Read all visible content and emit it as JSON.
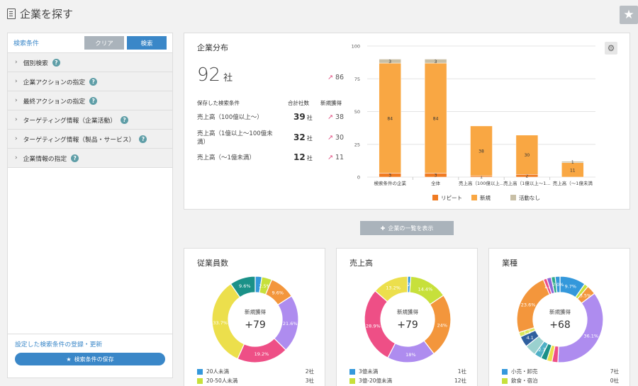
{
  "header": {
    "title": "企業を探す"
  },
  "sidebar": {
    "search_label": "検索条件",
    "clear_label": "クリア",
    "search_button": "検索",
    "items": [
      {
        "label": "個別検索"
      },
      {
        "label": "企業アクションの指定"
      },
      {
        "label": "最終アクションの指定"
      },
      {
        "label": "ターゲティング情報（企業活動）"
      },
      {
        "label": "ターゲティング情報（製品・サービス）"
      },
      {
        "label": "企業情報の指定"
      }
    ],
    "help_mark": "?",
    "register_link": "設定した検索条件の登録・更新",
    "save_button": "検索条件の保存"
  },
  "distribution": {
    "title": "企業分布",
    "total": "92",
    "total_unit": "社",
    "total_new": "86",
    "col_saved": "保存した検索条件",
    "col_total": "合計社数",
    "col_new": "新規獲得",
    "rows": [
      {
        "label": "売上高（100億以上～）",
        "count": "39",
        "unit": "社",
        "new": "38"
      },
      {
        "label": "売上高（1億以上～100億未満）",
        "count": "32",
        "unit": "社",
        "new": "30"
      },
      {
        "label": "売上高（～1億未満）",
        "count": "12",
        "unit": "社",
        "new": "11"
      }
    ]
  },
  "chart_data": [
    {
      "type": "bar",
      "stacked": true,
      "categories": [
        "検索条件の企業",
        "全体",
        "売上高（100億以上...",
        "売上高（1億以上～1...",
        "売上高（～1億未満"
      ],
      "series": [
        {
          "name": "リピート",
          "values": [
            3,
            3,
            1,
            2,
            0
          ],
          "color": "#f07b22"
        },
        {
          "name": "新規",
          "values": [
            84,
            84,
            38,
            30,
            11
          ],
          "color": "#f9a743"
        },
        {
          "name": "活動なし",
          "values": [
            3,
            3,
            0,
            0,
            1
          ],
          "color": "#c8bfa6"
        }
      ],
      "ylim": [
        0,
        100
      ],
      "yticks": [
        0,
        25,
        50,
        75,
        100
      ],
      "grid": true,
      "legend": "bottom"
    },
    {
      "type": "pie",
      "donut": true,
      "title": "従業員数",
      "center_label": "新規獲得",
      "center_value": "+79",
      "slices": [
        {
          "value": 2.5,
          "color": "#3498db",
          "label": ""
        },
        {
          "value": 3.8,
          "color": "#c7e03b",
          "label": "2.5%"
        },
        {
          "value": 9.6,
          "color": "#f3963c",
          "label": "9.6%"
        },
        {
          "value": 21.6,
          "color": "#ae8cef",
          "label": "21.6%"
        },
        {
          "value": 19.2,
          "color": "#ee4f86",
          "label": "19.2%"
        },
        {
          "value": 33.7,
          "color": "#ecdf4c",
          "label": "33.7%"
        },
        {
          "value": 9.6,
          "color": "#1b9188",
          "label": "9.6%"
        }
      ],
      "legend": [
        {
          "label": "20人未満",
          "value": "2社",
          "color": "#3498db"
        },
        {
          "label": "20-50人未満",
          "value": "3社",
          "color": "#c7e03b"
        }
      ]
    },
    {
      "type": "pie",
      "donut": true,
      "title": "売上高",
      "center_label": "新規獲得",
      "center_value": "+79",
      "slices": [
        {
          "value": 1.2,
          "color": "#3498db",
          "label": "1.2%"
        },
        {
          "value": 14.4,
          "color": "#c7e03b",
          "label": "14.4%"
        },
        {
          "value": 24,
          "color": "#f3963c",
          "label": "24%"
        },
        {
          "value": 18,
          "color": "#ae8cef",
          "label": "18%"
        },
        {
          "value": 28.9,
          "color": "#ee4f86",
          "label": "28.9%"
        },
        {
          "value": 13.5,
          "color": "#ecdf4c",
          "label": "13.2%"
        }
      ],
      "legend": [
        {
          "label": "3億未満",
          "value": "1社",
          "color": "#3498db"
        },
        {
          "label": "3億-20億未満",
          "value": "12社",
          "color": "#c7e03b"
        }
      ]
    },
    {
      "type": "pie",
      "donut": true,
      "title": "業種",
      "center_label": "新規獲得",
      "center_value": "+68",
      "slices": [
        {
          "value": 9.7,
          "color": "#3498db",
          "label": "9.7%"
        },
        {
          "value": 1.5,
          "color": "#c7e03b",
          "label": ""
        },
        {
          "value": 3.5,
          "color": "#f3963c",
          "label": "3.5%"
        },
        {
          "value": 36.1,
          "color": "#ae8cef",
          "label": "36.1%"
        },
        {
          "value": 2.2,
          "color": "#ee4f86",
          "label": ""
        },
        {
          "value": 2.0,
          "color": "#ecdf4c",
          "label": ""
        },
        {
          "value": 2.3,
          "color": "#1b9188",
          "label": ""
        },
        {
          "value": 2.7,
          "color": "#4fb0c6",
          "label": "2.7"
        },
        {
          "value": 4.3,
          "color": "#9ad1cf",
          "label": ""
        },
        {
          "value": 4.1,
          "color": "#2f5f9e",
          "label": "4.1"
        },
        {
          "value": 1.7,
          "color": "#d9e65c",
          "label": "1.2"
        },
        {
          "value": 23.6,
          "color": "#f3963c",
          "label": "23.6%"
        },
        {
          "value": 1.3,
          "color": "#ee4f86",
          "label": "1.2"
        },
        {
          "value": 1.7,
          "color": "#8e66d6",
          "label": ""
        },
        {
          "value": 1.5,
          "color": "#2eaa8a",
          "label": ""
        },
        {
          "value": 1.8,
          "color": "#3498db",
          "label": "2.0%"
        }
      ],
      "legend": [
        {
          "label": "小売・卸売",
          "value": "7社",
          "color": "#3498db"
        },
        {
          "label": "飲食・宿泊",
          "value": "0社",
          "color": "#c7e03b"
        }
      ]
    }
  ],
  "list_button": "企業の一覧を表示"
}
